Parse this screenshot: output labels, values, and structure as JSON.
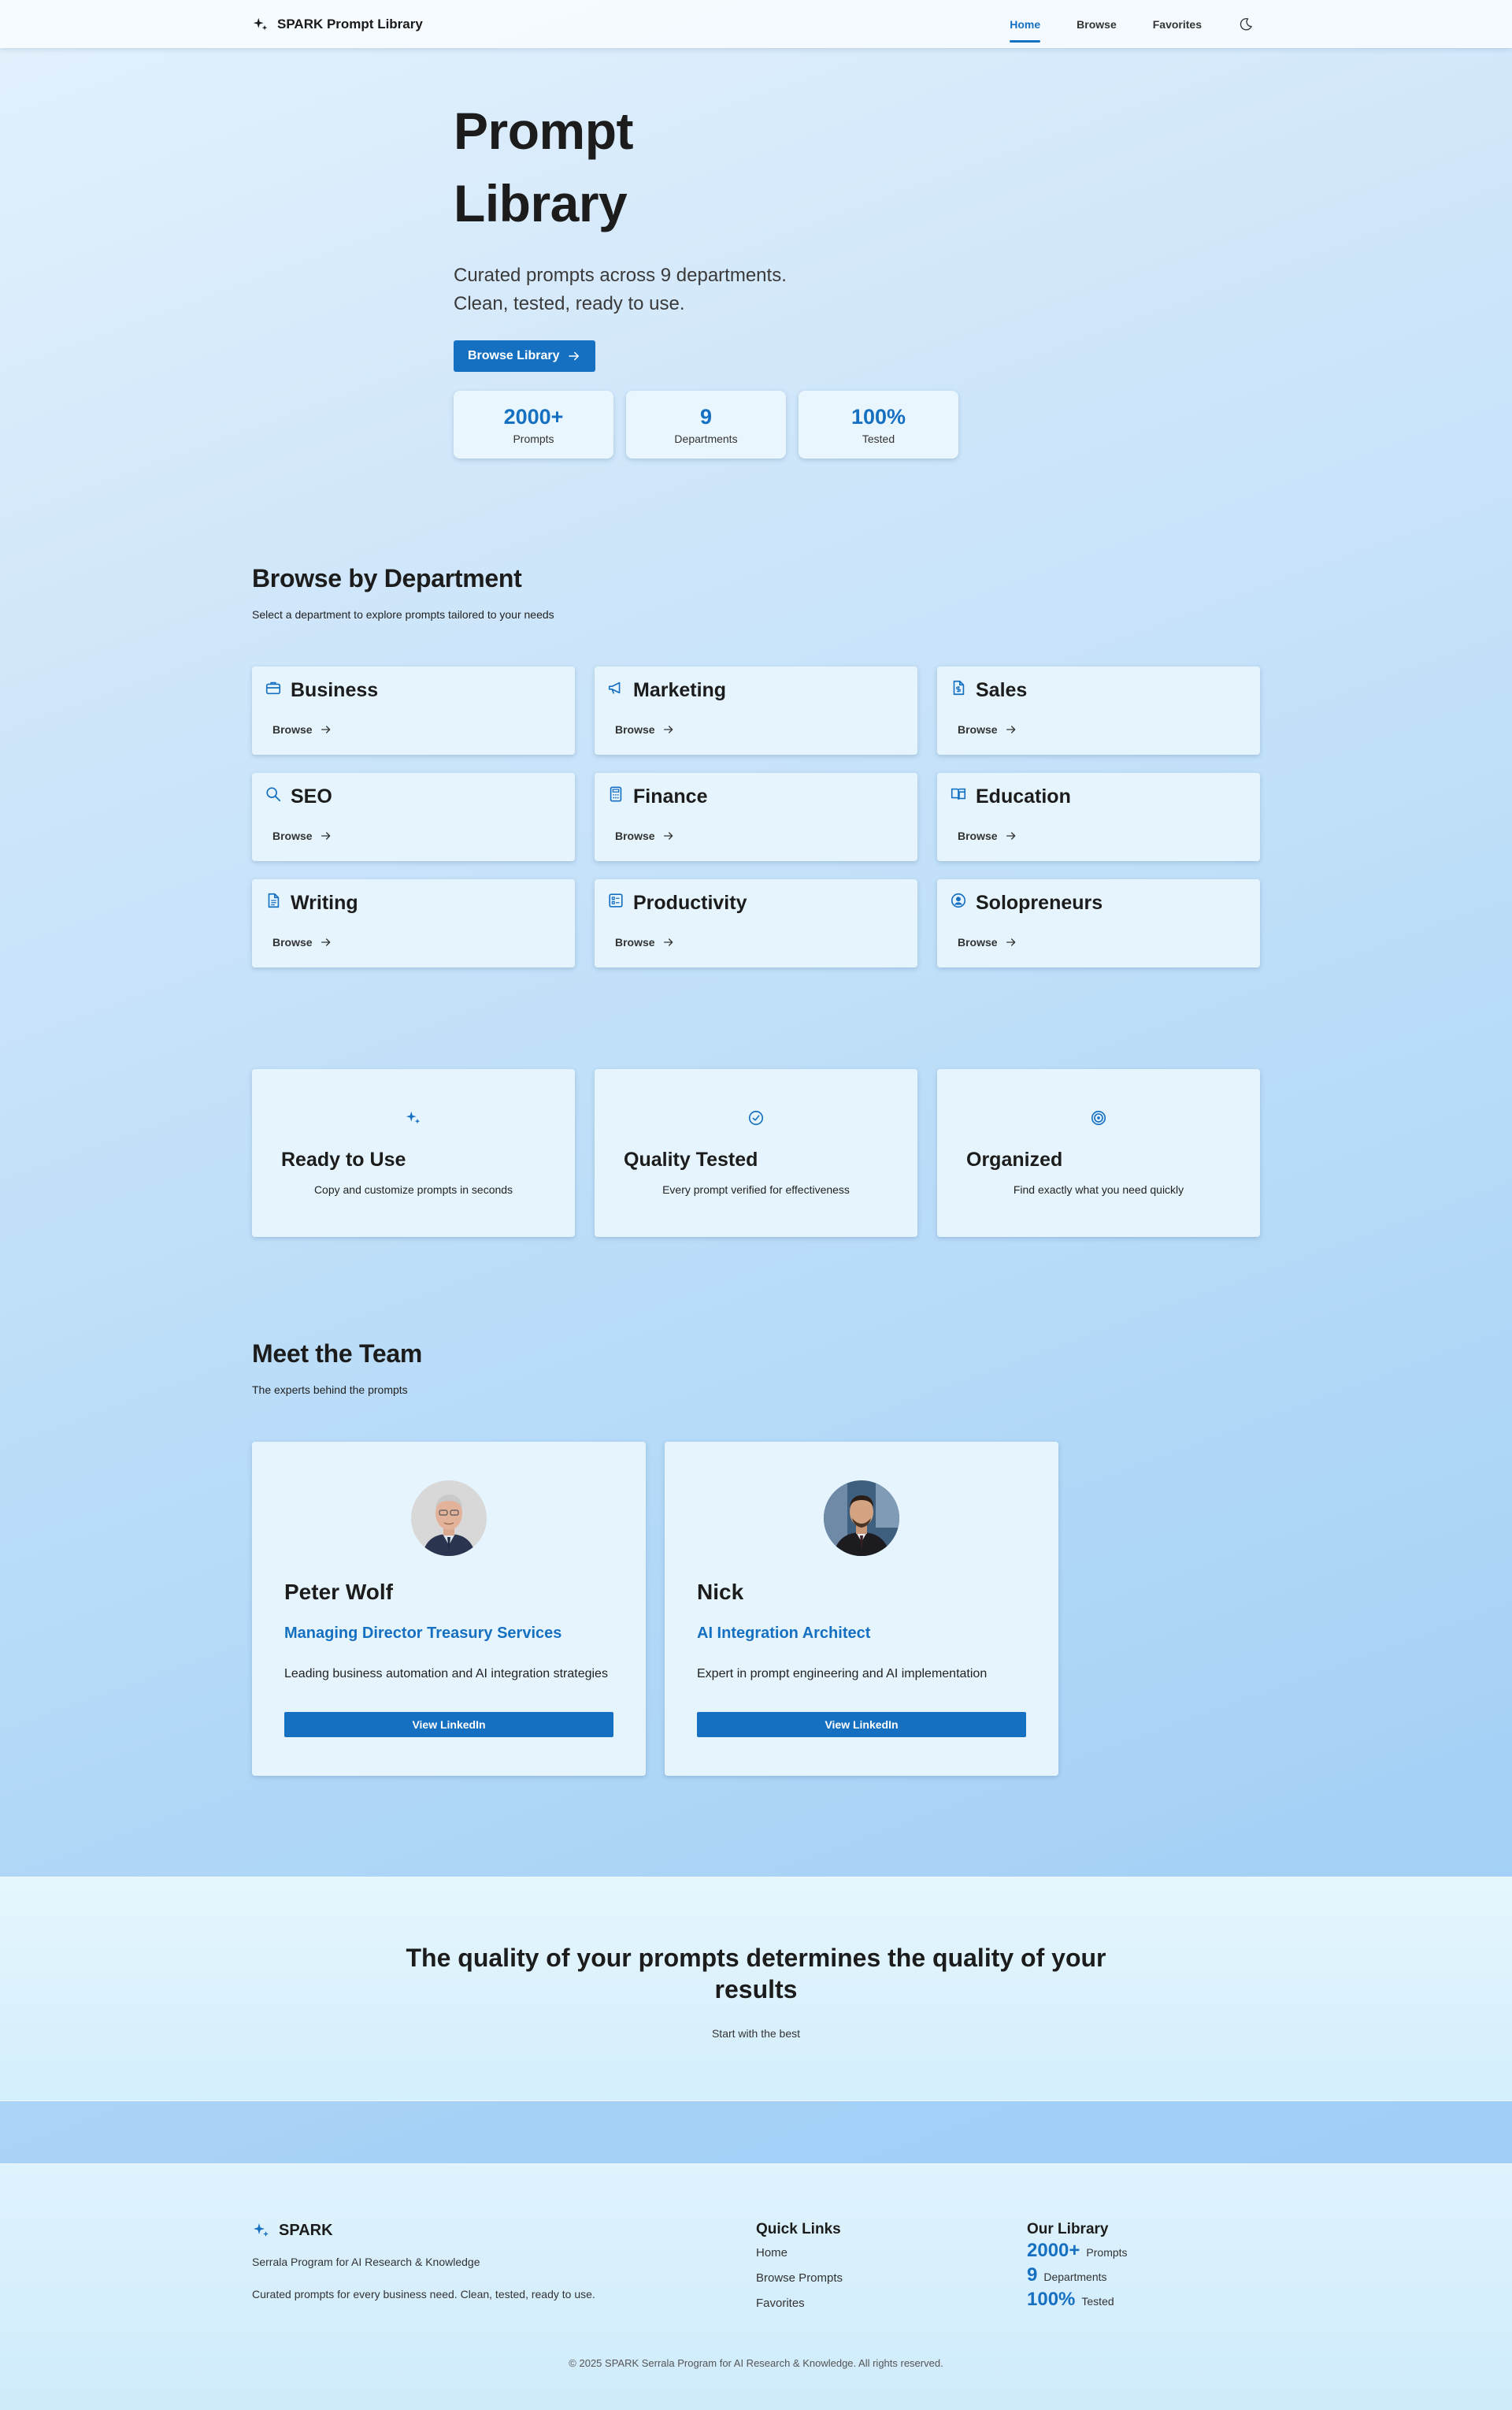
{
  "nav": {
    "brand": "SPARK Prompt Library",
    "links": [
      "Home",
      "Browse",
      "Favorites"
    ],
    "active": "Home"
  },
  "hero": {
    "title_line1": "Prompt",
    "title_line2": "Library",
    "subtitle_line1": "Curated prompts across 9 departments.",
    "subtitle_line2": "Clean, tested, ready to use.",
    "cta": "Browse Library",
    "stats": [
      {
        "value": "2000+",
        "label": "Prompts"
      },
      {
        "value": "9",
        "label": "Departments"
      },
      {
        "value": "100%",
        "label": "Tested"
      }
    ]
  },
  "departments": {
    "title": "Browse by Department",
    "subtitle": "Select a department to explore prompts tailored to your needs",
    "browse_label": "Browse",
    "items": [
      {
        "name": "Business",
        "icon": "briefcase-icon"
      },
      {
        "name": "Marketing",
        "icon": "megaphone-icon"
      },
      {
        "name": "Sales",
        "icon": "document-dollar-icon"
      },
      {
        "name": "SEO",
        "icon": "search-icon"
      },
      {
        "name": "Finance",
        "icon": "calculator-icon"
      },
      {
        "name": "Education",
        "icon": "book-icon"
      },
      {
        "name": "Writing",
        "icon": "document-icon"
      },
      {
        "name": "Productivity",
        "icon": "checklist-icon"
      },
      {
        "name": "Solopreneurs",
        "icon": "user-circle-icon"
      }
    ]
  },
  "features": [
    {
      "title": "Ready to Use",
      "desc": "Copy and customize prompts in seconds",
      "icon": "sparkle-icon"
    },
    {
      "title": "Quality Tested",
      "desc": "Every prompt verified for effectiveness",
      "icon": "check-circle-icon"
    },
    {
      "title": "Organized",
      "desc": "Find exactly what you need quickly",
      "icon": "target-icon"
    }
  ],
  "team": {
    "title": "Meet the Team",
    "subtitle": "The experts behind the prompts",
    "members": [
      {
        "name": "Peter Wolf",
        "role": "Managing Director Treasury Services",
        "bio": "Leading business automation and AI integration strategies",
        "button": "View LinkedIn"
      },
      {
        "name": "Nick",
        "role": "AI Integration Architect",
        "bio": "Expert in prompt engineering and AI implementation",
        "button": "View LinkedIn"
      }
    ]
  },
  "quote": {
    "title": "The quality of your prompts determines the quality of your results",
    "subtitle": "Start with the best"
  },
  "footer": {
    "brand": "SPARK",
    "tagline": "Serrala Program for AI Research & Knowledge",
    "description": "Curated prompts for every business need. Clean, tested, ready to use.",
    "quick_links_title": "Quick Links",
    "quick_links": [
      "Home",
      "Browse Prompts",
      "Favorites"
    ],
    "library_title": "Our Library",
    "library_stats": [
      {
        "value": "2000+",
        "label": "Prompts"
      },
      {
        "value": "9",
        "label": "Departments"
      },
      {
        "value": "100%",
        "label": "Tested"
      }
    ],
    "copyright": "© 2025 SPARK Serrala Program for AI Research & Knowledge. All rights reserved."
  },
  "colors": {
    "accent": "#1670c2",
    "card": "#e6f5fd",
    "text": "#1c1c1c"
  }
}
